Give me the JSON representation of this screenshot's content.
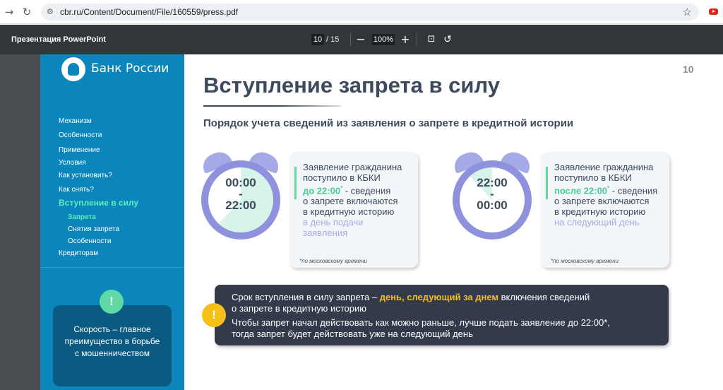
{
  "browser": {
    "url": "cbr.ru/Content/Document/File/160559/press.pdf"
  },
  "pdf_toolbar": {
    "title": "Презентация PowerPoint",
    "current_page": "10",
    "total_pages": "/ 15",
    "zoom": "100%"
  },
  "sidebar": {
    "logo_text": "Банк России",
    "menu": [
      "Механизм",
      "Особенности",
      "Применение",
      "Условия",
      "Как установить?",
      "Как снять?",
      "Вступление в силу"
    ],
    "submenu": [
      "Запрета",
      "Снятия запрета",
      "Особенности"
    ],
    "last_item": "Кредиторам",
    "tip_badge": "!",
    "tip_text": "Скорость – главное преимущество в борьбе с мошенничеством"
  },
  "slide": {
    "number": "10",
    "title": "Вступление запрета в силу",
    "subtitle": "Порядок учета сведений из заявления о запрете в кредитной истории",
    "clock1": {
      "top": "00:00",
      "dash": "-",
      "bottom": "22:00"
    },
    "clock2": {
      "top": "22:00",
      "dash": "-",
      "bottom": "00:00"
    },
    "card1": {
      "line1": "Заявление гражданина",
      "line2": "поступило в КБКИ",
      "highlight": "до 22:00",
      "asterisk": "*",
      "after_highlight": " - сведения",
      "line4": "о запрете включаются",
      "line5": "в кредитную историю",
      "dim1": "в день подачи",
      "dim2": "заявления",
      "note": "*по московскому времени"
    },
    "card2": {
      "line1": "Заявление гражданина",
      "line2": "поступило в КБКИ",
      "highlight": "после 22:00",
      "asterisk": "*",
      "after_highlight": " - сведения",
      "line4": "о запрете включаются",
      "line5": "в кредитную историю",
      "dim1": "на следующий день",
      "note": "*по московскому времени"
    },
    "notice": {
      "badge": "!",
      "line1_pre": "Срок вступления в силу запрета – ",
      "line1_hl": "день, следующий за днем",
      "line1_post": " включения сведений",
      "line2": "о запрете в кредитную историю",
      "line3": "Чтобы запрет начал действовать как можно раньше, лучше подать заявление до 22:00*,",
      "line4": "тогда запрет будет действовать уже на следующий день"
    }
  },
  "colors": {
    "sidebar": "#0a86bd",
    "accent_green": "#5ef0b5",
    "clock_ring": "#8e91dc",
    "notice_bg": "#333a4a",
    "notice_highlight": "#f6bf1a"
  }
}
